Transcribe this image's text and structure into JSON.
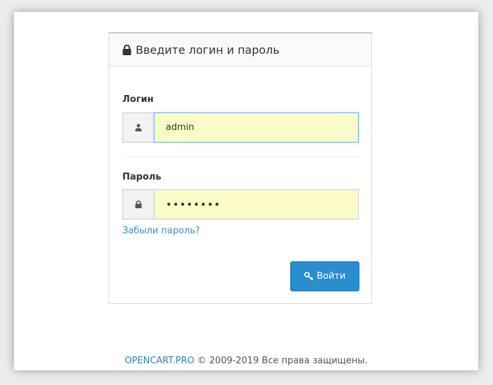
{
  "panel": {
    "heading": "Введите логин и пароль"
  },
  "form": {
    "username_label": "Логин",
    "username_value": "admin",
    "password_label": "Пароль",
    "password_value": "••••••••",
    "forgot_link": "Забыли пароль?",
    "submit_label": "Войти"
  },
  "footer": {
    "brand_link": "OPENCART.PRO",
    "copyright": " © 2009-2019 Все права защищены."
  },
  "icons": {
    "heading": "lock-icon",
    "username": "user-icon",
    "password": "lock-icon",
    "submit": "key-icon"
  },
  "colors": {
    "accent": "#2a8dd0",
    "link": "#3d8fc1",
    "autofill": "#fbfbc8"
  }
}
